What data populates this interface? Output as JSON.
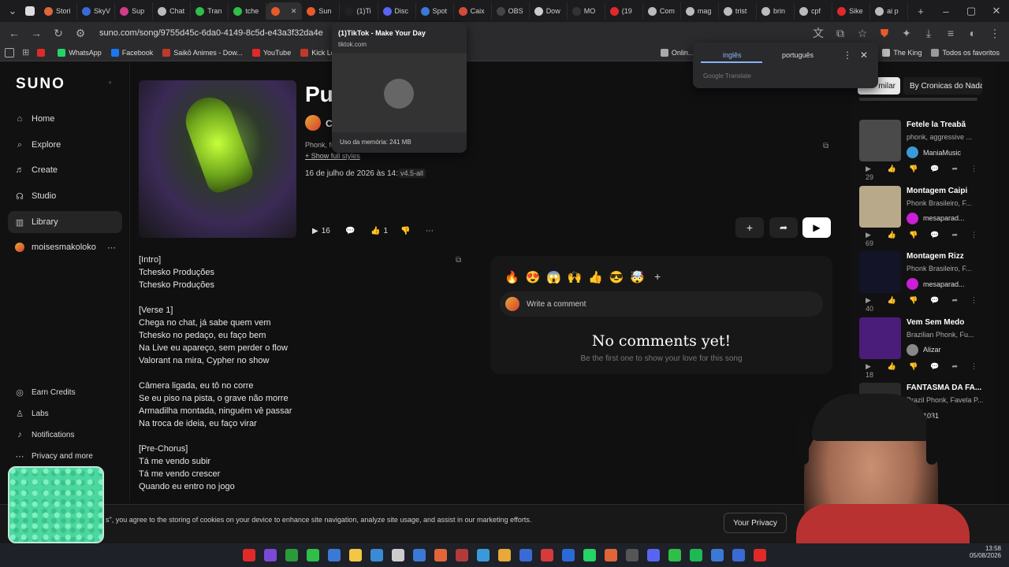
{
  "tabs": [
    {
      "label": "Stori",
      "color": "#e0663a"
    },
    {
      "label": "SkyV",
      "color": "#3a6ad6"
    },
    {
      "label": "Sup",
      "color": "#d63a8a"
    },
    {
      "label": "Chat",
      "color": "#bbbbbb"
    },
    {
      "label": "Tran",
      "color": "#2fbf48"
    },
    {
      "label": "tche",
      "color": "#2fbf48"
    },
    {
      "label": "",
      "color": "#e85a2a"
    },
    {
      "label": "Sun",
      "color": "#e85a2a"
    },
    {
      "label": "(1)Ti",
      "color": "#222222"
    },
    {
      "label": "Disc",
      "color": "#5865f2"
    },
    {
      "label": "Spot",
      "color": "#3a7ad6"
    },
    {
      "label": "Caix",
      "color": "#d64a3a"
    },
    {
      "label": "OBS",
      "color": "#444444"
    },
    {
      "label": "Dow",
      "color": "#cccccc"
    },
    {
      "label": "MO",
      "color": "#333333"
    },
    {
      "label": "(19",
      "color": "#e02a2a"
    },
    {
      "label": "Com",
      "color": "#bbbbbb"
    },
    {
      "label": "mag",
      "color": "#bbbbbb"
    },
    {
      "label": "trist",
      "color": "#bbbbbb"
    },
    {
      "label": "brin",
      "color": "#bbbbbb"
    },
    {
      "label": "cpf",
      "color": "#bbbbbb"
    },
    {
      "label": "Sike",
      "color": "#e02a2a"
    },
    {
      "label": "ai p",
      "color": "#bbbbbb"
    }
  ],
  "address": {
    "url": "suno.com/song/9755d45c-6da0-4149-8c5d-e43a3f32da4e"
  },
  "bookmarks": [
    {
      "label": "",
      "color": "#e02a2a"
    },
    {
      "label": "WhatsApp",
      "color": "#25d366"
    },
    {
      "label": "Facebook",
      "color": "#1877f2"
    },
    {
      "label": "Saikō Animes - Dow...",
      "color": "#c0392b"
    },
    {
      "label": "YouTube",
      "color": "#e02a2a"
    },
    {
      "label": "Kick Logo",
      "color": "#c0392b"
    }
  ],
  "bookmarks_right": [
    {
      "label": "Onlin...",
      "color": "#aaaaaa"
    },
    {
      "label": "Family Otaku: DICIO...",
      "color": "#f2c744"
    },
    {
      "label": "(42) Scorpions - Wi...",
      "color": "#e02a2a"
    },
    {
      "label": "The King",
      "color": "#bbbbbb"
    },
    {
      "label": "Todos os favoritos",
      "color": "#999999"
    }
  ],
  "sidebar": {
    "logo": "SUNO",
    "items": [
      "Home",
      "Explore",
      "Create",
      "Studio",
      "Library"
    ],
    "icons": [
      "⌂",
      "⌕",
      "♬",
      "☊",
      "▥"
    ],
    "user": "moisesmakoloko",
    "bottom": [
      "Earn Credits",
      "Labs",
      "Notifications",
      "Privacy and more"
    ],
    "bottom_icons": [
      "◎",
      "♙",
      "♪",
      "⋯"
    ]
  },
  "song": {
    "title": "Put",
    "artist_initial": "C",
    "styles": "Phonk, fur",
    "show_styles": "+ Show full styles",
    "date": "16 de julho de 2026 às 14:08",
    "version": "v4.5-all",
    "plays": "16",
    "likes": "1"
  },
  "lyrics": [
    "[Intro]",
    "Tchesko Produções",
    "Tchesko Produções",
    "",
    "[Verse 1]",
    "Chega no chat, já sabe quem vem",
    "Tchesko no pedaço, eu faço bem",
    "Na Live eu apareço, sem perder o flow",
    "Valorant na mira, Cypher no show",
    "",
    "Câmera ligada, eu tô no corre",
    "Se eu piso na pista, o grave não morre",
    "Armadilha montada, ninguém vê passar",
    "Na troca de ideia, eu faço virar",
    "",
    "[Pre-Chorus]",
    "Tá me vendo subir",
    "Tá me vendo crescer",
    "Quando eu entro no jogo"
  ],
  "comments": {
    "emojis": [
      "🔥",
      "😍",
      "😱",
      "🙌",
      "👍",
      "😎",
      "🤯"
    ],
    "placeholder": "Write a comment",
    "empty_title": "No comments yet!",
    "empty_sub": "Be the first one to show your love for this song"
  },
  "right": {
    "tab_partial": "milar",
    "tab_other": "By Cronicas do Nada",
    "items": [
      {
        "title": "Fetele la Treabă",
        "sub": "phonk, aggressive ...",
        "author": "ManiaMusic",
        "plays": "29",
        "thumb": "#4a4a4a",
        "av": "#3a9ad9"
      },
      {
        "title": "Montagem Caipi",
        "sub": "Phonk Brasileiro, F...",
        "author": "mesaparad...",
        "plays": "69",
        "thumb": "#b7a98a",
        "av": "#c91fd6"
      },
      {
        "title": "Montagem Rizz",
        "sub": "Phonk Brasileiro, F...",
        "author": "mesaparad...",
        "plays": "40",
        "thumb": "#141428",
        "av": "#c91fd6"
      },
      {
        "title": "Vem Sem Medo",
        "sub": "Brazilian Phonk, Fu...",
        "author": "Alizar",
        "plays": "18",
        "thumb": "#4a1d7a",
        "av": "#888888"
      },
      {
        "title": "FANTASMA DA FA...",
        "sub": "Brazil Phonk, Favela P...",
        "author": "1031",
        "plays": "",
        "thumb": "#2a2a2a",
        "av": "#777777"
      }
    ]
  },
  "tab_preview": {
    "title": "(1)TikTok - Make Your Day",
    "domain": "tiktok.com",
    "memory": "Uso da memória: 241 MB"
  },
  "translate": {
    "lang1": "inglês",
    "lang2": "português",
    "footer": "Google Translate"
  },
  "cookie": {
    "text": "s\", you agree to the storing of cookies on your device to enhance site navigation, analyze site usage, and assist in our marketing efforts.",
    "button": "Your Privacy"
  },
  "taskbar": {
    "date": "05/08/2026",
    "time": "13:58"
  },
  "taskbar_icons": [
    "#e02a2a",
    "#7a4ad6",
    "#2a9a3a",
    "#2fbf48",
    "#3a7ad6",
    "#f2c744",
    "#3a8ad6",
    "#cccccc",
    "#3a7ad6",
    "#e0663a",
    "#b33a3a",
    "#3a9ad9",
    "#e8a83a",
    "#3a6ad6",
    "#d63a3a",
    "#2a6ad6",
    "#25d366",
    "#e0663a",
    "#555555",
    "#5865f2",
    "#2fbf48",
    "#1db954",
    "#3a7ad6",
    "#3a6ad6",
    "#e02a2a"
  ]
}
